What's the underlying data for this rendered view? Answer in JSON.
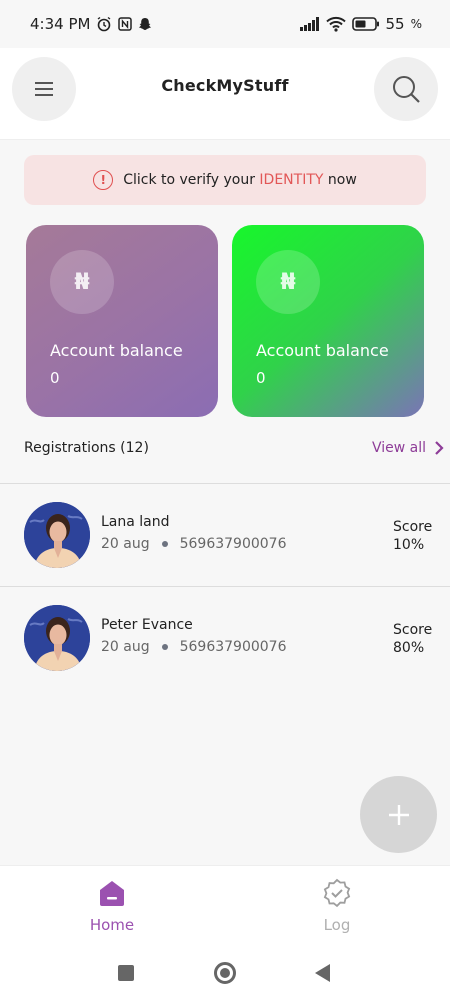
{
  "status_bar": {
    "time": "4:34 PM",
    "battery": "55"
  },
  "header": {
    "title": "CheckMyStuff"
  },
  "banner": {
    "prefix": "Click to verify your ",
    "highlight": "IDENTITY",
    "suffix": " now"
  },
  "cards": [
    {
      "currency_symbol": "₦",
      "label": "Account balance",
      "value": "0"
    },
    {
      "currency_symbol": "₦",
      "label": "Account balance",
      "value": "0"
    }
  ],
  "registrations": {
    "title": "Registrations (12)",
    "view_all": "View all",
    "items": [
      {
        "name": "Lana land",
        "date": "20 aug",
        "id": "569637900076",
        "score_label": "Score",
        "score": "10%"
      },
      {
        "name": "Peter Evance",
        "date": "20 aug",
        "id": "569637900076",
        "score_label": "Score",
        "score": "80%"
      }
    ]
  },
  "bottom_nav": {
    "home": "Home",
    "log": "Log"
  },
  "colors": {
    "accent": "#9b51b0",
    "alert": "#e25757",
    "banner_bg": "#f7e3e3"
  }
}
